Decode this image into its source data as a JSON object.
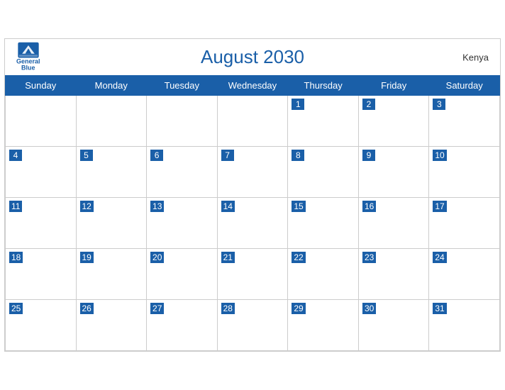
{
  "calendar": {
    "month": "August",
    "year": "2030",
    "title": "August 2030",
    "country": "Kenya",
    "days_of_week": [
      "Sunday",
      "Monday",
      "Tuesday",
      "Wednesday",
      "Thursday",
      "Friday",
      "Saturday"
    ],
    "weeks": [
      [
        null,
        null,
        null,
        null,
        1,
        2,
        3
      ],
      [
        4,
        5,
        6,
        7,
        8,
        9,
        10
      ],
      [
        11,
        12,
        13,
        14,
        15,
        16,
        17
      ],
      [
        18,
        19,
        20,
        21,
        22,
        23,
        24
      ],
      [
        25,
        26,
        27,
        28,
        29,
        30,
        31
      ]
    ]
  },
  "logo": {
    "general": "General",
    "blue": "Blue"
  }
}
